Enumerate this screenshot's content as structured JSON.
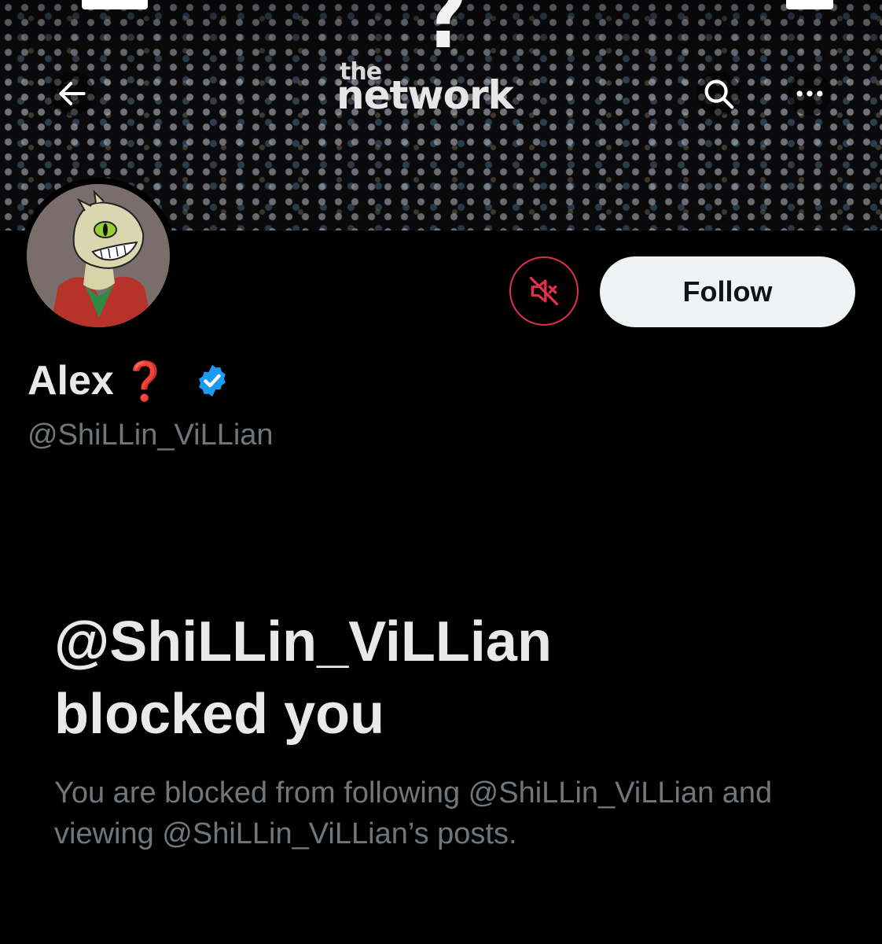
{
  "banner": {
    "logo_small": "the",
    "logo_large": "network",
    "logo_mark": "?"
  },
  "nav": {
    "back_icon": "arrow-left-icon",
    "search_icon": "search-icon",
    "more_icon": "more-horizontal-icon"
  },
  "profile": {
    "display_name": "Alex",
    "name_emoji": "❓",
    "verified": true,
    "handle": "@ShiLLin_ViLLian"
  },
  "actions": {
    "mute_icon": "muted-speaker-icon",
    "follow_label": "Follow"
  },
  "blocked": {
    "title_line1": "@ShiLLin_ViLLian",
    "title_line2": "blocked you",
    "description": "You are blocked from following @ShiLLin_ViLLian and viewing @ShiLLin_ViLLian’s posts."
  },
  "colors": {
    "background": "#000000",
    "text_primary": "#e7e9ea",
    "text_secondary": "#71767b",
    "follow_bg": "#eff3f4",
    "mute_accent": "#e0304a",
    "verified_blue": "#1d9bf0"
  }
}
